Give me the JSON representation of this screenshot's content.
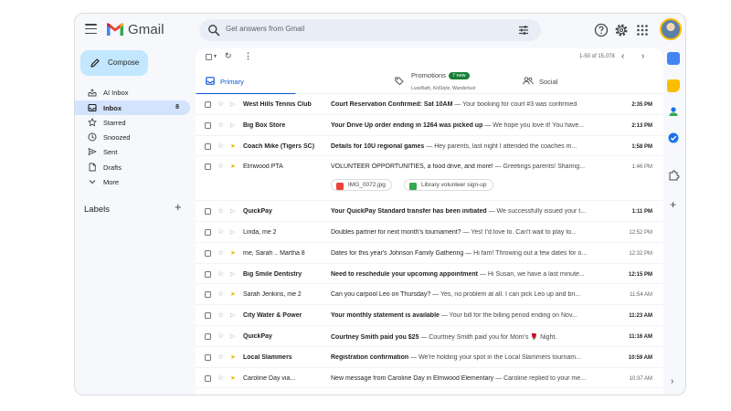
{
  "app": {
    "brand": "Gmail",
    "brand_colors": [
      "#ea4335",
      "#4285f4",
      "#34a853",
      "#fbbc04"
    ]
  },
  "header": {
    "search_placeholder": "Get answers from Gmail",
    "icons": [
      "menu-icon",
      "search-icon",
      "tune-icon",
      "help-icon",
      "settings-icon",
      "apps-icon",
      "avatar"
    ]
  },
  "sidebar": {
    "compose_label": "Compose",
    "items": [
      {
        "label": "AI Inbox",
        "icon": "ai-inbox-icon",
        "active": false,
        "count": ""
      },
      {
        "label": "Inbox",
        "icon": "inbox-icon",
        "active": true,
        "count": "8"
      },
      {
        "label": "Starred",
        "icon": "star-icon",
        "active": false,
        "count": ""
      },
      {
        "label": "Snoozed",
        "icon": "clock-icon",
        "active": false,
        "count": ""
      },
      {
        "label": "Sent",
        "icon": "send-icon",
        "active": false,
        "count": ""
      },
      {
        "label": "Drafts",
        "icon": "draft-icon",
        "active": false,
        "count": ""
      },
      {
        "label": "More",
        "icon": "chevron-down-icon",
        "active": false,
        "count": ""
      }
    ],
    "labels_title": "Labels",
    "labels_add": "+"
  },
  "toolbar": {
    "range": "1-50 of 15,078",
    "prev": "‹",
    "next": "›"
  },
  "tabs": [
    {
      "label": "Primary",
      "icon": "inbox-icon",
      "active": true
    },
    {
      "label": "Promotions",
      "badge": "7 new",
      "sub": "LuxeBath, KidStyle, Wanderlust",
      "icon": "tag-icon",
      "active": false
    },
    {
      "label": "Social",
      "icon": "people-icon",
      "active": false
    }
  ],
  "emails": [
    {
      "sender": "West Hills Tennis Club",
      "subject": "Court Reservation Confirmed: Sat 10AM",
      "snippet": " — Your booking for court #3 was confirmed",
      "time": "2:35 PM",
      "unread": true,
      "important": false
    },
    {
      "sender": "Big Box Store",
      "subject": "Your Drive Up order ending in 1264 was picked up",
      "snippet": " — We hope you love it! You have...",
      "time": "2:13 PM",
      "unread": true,
      "important": false
    },
    {
      "sender": "Coach Mike (Tigers SC)",
      "subject": "Details for 10U regional games",
      "snippet": " — Hey parents, last night I attended the coaches m...",
      "time": "1:58 PM",
      "unread": true,
      "important": true
    },
    {
      "sender": "Elmwood PTA",
      "subject": "VOLUNTEER OPPORTUNITIES, a food drive, and more!",
      "snippet": " — Greetings parents! Sharing...",
      "time": "1:46 PM",
      "unread": false,
      "important": true,
      "attachments": [
        {
          "label": "IMG_0072.jpg",
          "color": "#ea4335"
        },
        {
          "label": "Library volunteer sign-up",
          "color": "#34a853"
        }
      ]
    },
    {
      "sender": "QuickPay",
      "subject": "Your QuickPay Standard transfer has been initiated",
      "snippet": " — We successfully issued your t...",
      "time": "1:11 PM",
      "unread": true,
      "important": false
    },
    {
      "sender": "Linda, me 2",
      "subject": "Doubles partner for next month's tournament?",
      "snippet": " — Yes! I'd love to. Can't wait to play to...",
      "time": "12:52 PM",
      "unread": false,
      "important": false
    },
    {
      "sender": "me, Sarah .. Martha 8",
      "subject": "Dates for this year's Johnson Family Gathering",
      "snippet": " — Hi fam! Throwing out a few dates for o...",
      "time": "12:32 PM",
      "unread": false,
      "important": true
    },
    {
      "sender": "Big Smile Dentistry",
      "subject": "Need to reschedule your upcoming appointment",
      "snippet": " — Hi Susan, we have a last minute...",
      "time": "12:15 PM",
      "unread": true,
      "important": false
    },
    {
      "sender": "Sarah Jenkins, me 2",
      "subject": "Can you carpool Leo on Thursday?",
      "snippet": " — Yes, no problem at all. I can pick Leo up and bri...",
      "time": "11:54 AM",
      "unread": false,
      "important": true
    },
    {
      "sender": "City Water & Power",
      "subject": "Your monthly statement is available",
      "snippet": " — Your bill for the billing period ending on Nov...",
      "time": "11:23 AM",
      "unread": true,
      "important": false
    },
    {
      "sender": "QuickPay",
      "subject": "Courtney Smith paid you $25",
      "snippet": " — Courtney Smith paid you for Mom's 🌹 Night.",
      "time": "11:16 AM",
      "unread": true,
      "important": false
    },
    {
      "sender": "Local Slammers",
      "subject": "Registration confirmation",
      "snippet": " — We're holding your spot in the Local Slammers tournam...",
      "time": "10:59 AM",
      "unread": true,
      "important": true
    },
    {
      "sender": "Caroline Day via...",
      "subject": "New message from Caroline Day in Elmwood Elementary",
      "snippet": " — Caroline replied to your me...",
      "time": "10:37 AM",
      "unread": false,
      "important": true
    }
  ],
  "side_rail": [
    {
      "icon": "calendar-icon",
      "color": "#4285f4"
    },
    {
      "icon": "keep-icon",
      "color": "#fbbc04"
    },
    {
      "icon": "contacts-icon",
      "color": "#1a73e8"
    },
    {
      "icon": "tasks-icon",
      "color": "#1a73e8"
    },
    {
      "icon": "add-on-icon",
      "color": "#444746"
    }
  ],
  "rail_plus": "+",
  "rail_collapse": "›"
}
